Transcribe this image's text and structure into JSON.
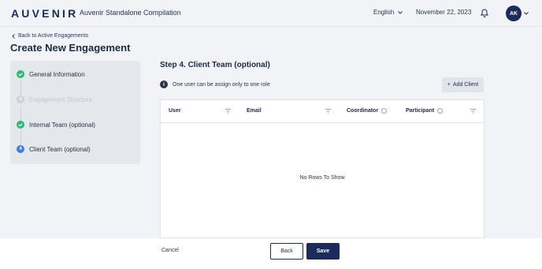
{
  "header": {
    "logo": "AUVENIR",
    "app_title": "Auvenir Standalone Compilation",
    "language": "English",
    "date": "November 22, 2023",
    "avatar_initials": "AK",
    "icons": {
      "notifications": "bell-icon",
      "language_caret": "chevron-down-icon",
      "avatar_caret": "chevron-down-icon"
    }
  },
  "nav": {
    "back_link": "Back to Active Engagements",
    "page_title": "Create New Engagement"
  },
  "stepper": {
    "steps": [
      {
        "label": "General Information",
        "state": "done",
        "marker": ""
      },
      {
        "label": "Engagement Structure",
        "state": "disabled",
        "marker": "2"
      },
      {
        "label": "Internal Team (optional)",
        "state": "done",
        "marker": ""
      },
      {
        "label": "Client Team (optional)",
        "state": "active",
        "marker": "4"
      }
    ]
  },
  "main": {
    "step_title": "Step 4. Client Team (optional)",
    "info_text": "One user can be assign only to one role",
    "info_icon": "i",
    "add_client_label": "Add Client",
    "add_client_icon": "+",
    "table": {
      "columns": [
        "User",
        "Email",
        "Coordinator",
        "Participant"
      ],
      "empty_message": "No Rows To Show"
    }
  },
  "footer": {
    "cancel_label": "Cancel",
    "back_label": "Back",
    "save_label": "Save"
  },
  "colors": {
    "brand": "#1a2b5c",
    "success": "#2eb872",
    "active": "#3b7de0",
    "background": "#f1f3f6"
  }
}
